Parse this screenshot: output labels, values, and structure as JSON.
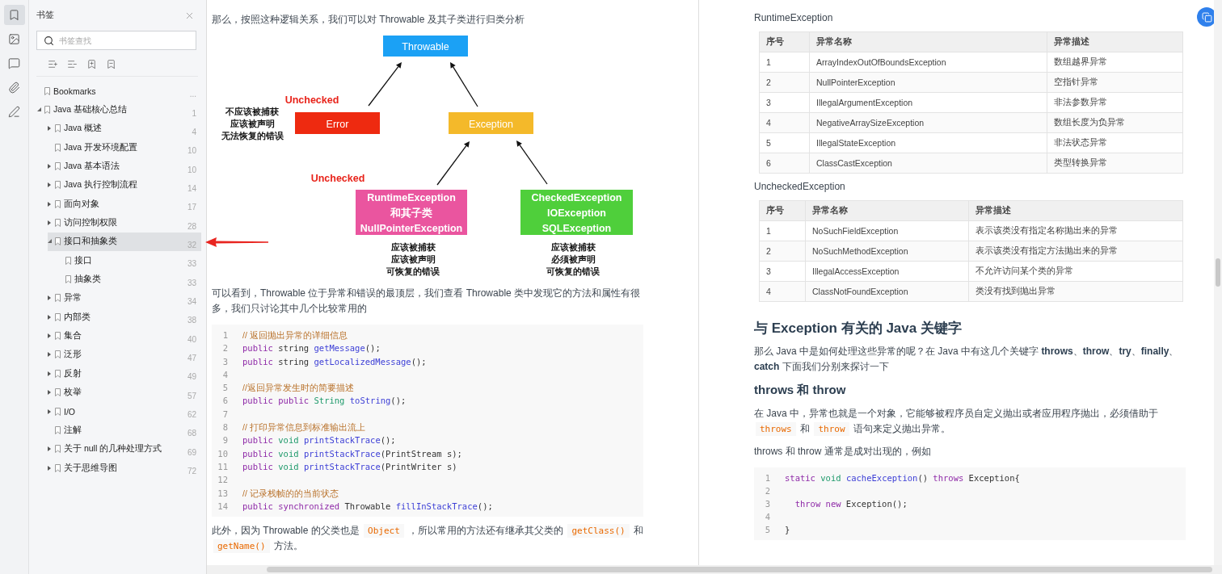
{
  "rail": [
    {
      "selected": true
    },
    {
      "selected": false
    },
    {
      "selected": false
    },
    {
      "selected": false
    },
    {
      "selected": false
    }
  ],
  "bookmark_panel": {
    "title": "书签",
    "search": {
      "placeholder": "书签查找"
    },
    "tree": [
      {
        "label": "Bookmarks",
        "page": "...",
        "kind": "leaf",
        "selected": false
      },
      {
        "label": "Java 基础核心总结",
        "page": "1",
        "kind": "folder",
        "expanded": true,
        "selected": false,
        "children": [
          {
            "label": "Java 概述",
            "page": "4",
            "kind": "folder",
            "expanded": false,
            "selected": false
          },
          {
            "label": "Java 开发环境配置",
            "page": "10",
            "kind": "leaf",
            "selected": false
          },
          {
            "label": "Java 基本语法",
            "page": "10",
            "kind": "folder",
            "expanded": false,
            "selected": false
          },
          {
            "label": "Java 执行控制流程",
            "page": "14",
            "kind": "folder",
            "expanded": false,
            "selected": false
          },
          {
            "label": "面向对象",
            "page": "17",
            "kind": "folder",
            "expanded": false,
            "selected": false
          },
          {
            "label": "访问控制权限",
            "page": "28",
            "kind": "folder",
            "expanded": false,
            "selected": false
          },
          {
            "label": "接口和抽象类",
            "page": "32",
            "kind": "folder",
            "expanded": true,
            "selected": true,
            "children": [
              {
                "label": "接口",
                "page": "33",
                "kind": "leaf",
                "selected": false
              },
              {
                "label": "抽象类",
                "page": "33",
                "kind": "leaf",
                "selected": false
              }
            ]
          },
          {
            "label": "异常",
            "page": "34",
            "kind": "folder",
            "expanded": false,
            "selected": false
          },
          {
            "label": "内部类",
            "page": "38",
            "kind": "folder",
            "expanded": false,
            "selected": false
          },
          {
            "label": "集合",
            "page": "40",
            "kind": "folder",
            "expanded": false,
            "selected": false
          },
          {
            "label": "泛形",
            "page": "47",
            "kind": "folder",
            "expanded": false,
            "selected": false
          },
          {
            "label": "反射",
            "page": "49",
            "kind": "folder",
            "expanded": false,
            "selected": false
          },
          {
            "label": "枚举",
            "page": "57",
            "kind": "folder",
            "expanded": false,
            "selected": false
          },
          {
            "label": "I/O",
            "page": "62",
            "kind": "folder",
            "expanded": false,
            "selected": false
          },
          {
            "label": "注解",
            "page": "68",
            "kind": "leaf",
            "selected": false
          },
          {
            "label": "关于 null 的几种处理方式",
            "page": "69",
            "kind": "folder",
            "expanded": false,
            "selected": false
          },
          {
            "label": "关于思维导图",
            "page": "72",
            "kind": "folder",
            "expanded": false,
            "selected": false
          }
        ]
      }
    ]
  },
  "left_page": {
    "intro": "那么，按照这种逻辑关系，我们可以对 Throwable 及其子类进行归类分析",
    "diagram": {
      "nodes": [
        {
          "lines": [
            "Throwable"
          ],
          "color": "#1ba1f5"
        },
        {
          "lines": [
            "Error"
          ],
          "color": "#ee2a10"
        },
        {
          "lines": [
            "Exception"
          ],
          "color": "#f4b92a"
        },
        {
          "lines": [
            "RuntimeException",
            "和其子类",
            "NullPointerException"
          ],
          "color": "#ea559f"
        },
        {
          "lines": [
            "CheckedException",
            "IOException",
            "SQLException"
          ],
          "color": "#4fcf3b"
        }
      ],
      "tags": [
        "Unchecked",
        "Unchecked"
      ],
      "notes": [
        [
          "不应该被捕获",
          "应该被声明",
          "无法恢复的错误"
        ],
        [
          "应该被捕获",
          "应该被声明",
          "可恢复的错误"
        ],
        [
          "应该被捕获",
          "必须被声明",
          "可恢复的错误"
        ]
      ]
    },
    "para": "可以看到，Throwable 位于异常和错误的最顶层，我们查看 Throwable 类中发现它的方法和属性有很多，我们只讨论其中几个比较常用的",
    "code": [
      {
        "n": "1",
        "tokens": [
          {
            "t": "// 返回抛出异常的详细信息",
            "kind": "comment"
          }
        ]
      },
      {
        "n": "2",
        "tokens": [
          {
            "t": "public",
            "kind": "keyword"
          },
          {
            "t": " string ",
            "kind": "plain"
          },
          {
            "t": "getMessage",
            "kind": "function"
          },
          {
            "t": "();",
            "kind": "plain"
          }
        ]
      },
      {
        "n": "3",
        "tokens": [
          {
            "t": "public",
            "kind": "keyword"
          },
          {
            "t": " string ",
            "kind": "plain"
          },
          {
            "t": "getLocalizedMessage",
            "kind": "function"
          },
          {
            "t": "();",
            "kind": "plain"
          }
        ]
      },
      {
        "n": "4"
      },
      {
        "n": "5",
        "tokens": [
          {
            "t": "//返回异常发生时的简要描述",
            "kind": "comment"
          }
        ]
      },
      {
        "n": "6",
        "tokens": [
          {
            "t": "public public ",
            "kind": "keyword"
          },
          {
            "t": "String ",
            "kind": "type"
          },
          {
            "t": "toString",
            "kind": "function"
          },
          {
            "t": "();",
            "kind": "plain"
          }
        ]
      },
      {
        "n": "7"
      },
      {
        "n": "8",
        "tokens": [
          {
            "t": "// 打印异常信息到标准输出流上",
            "kind": "comment"
          }
        ]
      },
      {
        "n": "9",
        "tokens": [
          {
            "t": "public ",
            "kind": "keyword"
          },
          {
            "t": "void ",
            "kind": "type"
          },
          {
            "t": "printStackTrace",
            "kind": "function"
          },
          {
            "t": "();",
            "kind": "plain"
          }
        ]
      },
      {
        "n": "10",
        "tokens": [
          {
            "t": "public ",
            "kind": "keyword"
          },
          {
            "t": "void ",
            "kind": "type"
          },
          {
            "t": "printStackTrace",
            "kind": "function"
          },
          {
            "t": "(PrintStream s);",
            "kind": "plain"
          }
        ]
      },
      {
        "n": "11",
        "tokens": [
          {
            "t": "public ",
            "kind": "keyword"
          },
          {
            "t": "void ",
            "kind": "type"
          },
          {
            "t": "printStackTrace",
            "kind": "function"
          },
          {
            "t": "(PrintWriter s)",
            "kind": "plain"
          }
        ]
      },
      {
        "n": "12"
      },
      {
        "n": "13",
        "tokens": [
          {
            "t": "// 记录栈帧的的当前状态",
            "kind": "comment"
          }
        ]
      },
      {
        "n": "14",
        "tokens": [
          {
            "t": "public synchronized",
            "kind": "keyword"
          },
          {
            "t": " Throwable ",
            "kind": "plain"
          },
          {
            "t": "fillInStackTrace",
            "kind": "function"
          },
          {
            "t": "();",
            "kind": "plain"
          }
        ]
      }
    ],
    "outro": [
      {
        "t": "此外，因为 Throwable 的父类也是 ",
        "kind": "text"
      },
      {
        "t": "Object",
        "kind": "code"
      },
      {
        "t": " ，所以常用的方法还有继承其父类的 ",
        "kind": "text"
      },
      {
        "t": "getClass()",
        "kind": "code"
      },
      {
        "t": " 和 ",
        "kind": "text"
      },
      {
        "t": "getName()",
        "kind": "code"
      },
      {
        "t": " 方法。",
        "kind": "text"
      }
    ]
  },
  "right_page": {
    "tables": [
      {
        "caption": "RuntimeException",
        "columns": [
          "序号",
          "异常名称",
          "异常描述"
        ],
        "rows": [
          [
            "1",
            "ArrayIndexOutOfBoundsException",
            "数组越界异常"
          ],
          [
            "2",
            "NullPointerException",
            "空指针异常"
          ],
          [
            "3",
            "IllegalArgumentException",
            "非法参数异常"
          ],
          [
            "4",
            "NegativeArraySizeException",
            "数组长度为负异常"
          ],
          [
            "5",
            "IllegalStateException",
            "非法状态异常"
          ],
          [
            "6",
            "ClassCastException",
            "类型转换异常"
          ]
        ]
      },
      {
        "caption": "UncheckedException",
        "columns": [
          "序号",
          "异常名称",
          "异常描述"
        ],
        "rows": [
          [
            "1",
            "NoSuchFieldException",
            "表示该类没有指定名称抛出来的异常"
          ],
          [
            "2",
            "NoSuchMethodException",
            "表示该类没有指定方法抛出来的异常"
          ],
          [
            "3",
            "IllegalAccessException",
            "不允许访问某个类的异常"
          ],
          [
            "4",
            "ClassNotFoundException",
            "类没有找到抛出异常"
          ]
        ]
      }
    ],
    "heading": "与 Exception 有关的 Java 关键字",
    "para1": "那么 Java 中是如何处理这些异常的呢？在 Java 中有这几个关键字 **throws**、**throw**、**try**、**finally**、**catch** 下面我们分别来探讨一下",
    "subheading": "throws 和 throw",
    "para2": [
      {
        "t": "在 Java 中，异常也就是一个对象，它能够被程序员自定义抛出或者应用程序抛出，必须借助于 ",
        "kind": "text"
      },
      {
        "t": "throws",
        "kind": "code"
      },
      {
        "t": " 和 ",
        "kind": "text"
      },
      {
        "t": "throw",
        "kind": "code"
      },
      {
        "t": " 语句来定义抛出异常。",
        "kind": "text"
      }
    ],
    "para3": "throws 和 throw 通常是成对出现的，例如",
    "code": [
      {
        "n": "1",
        "tokens": [
          {
            "t": "static ",
            "kind": "keyword"
          },
          {
            "t": "void ",
            "kind": "type"
          },
          {
            "t": "cacheException",
            "kind": "function"
          },
          {
            "t": "() ",
            "kind": "plain"
          },
          {
            "t": "throws",
            "kind": "keyword"
          },
          {
            "t": " Exception{",
            "kind": "plain"
          }
        ]
      },
      {
        "n": "2"
      },
      {
        "n": "3",
        "tokens": [
          {
            "t": "  throw new",
            "kind": "keyword"
          },
          {
            "t": " Exception();",
            "kind": "plain"
          }
        ]
      },
      {
        "n": "4"
      },
      {
        "n": "5",
        "tokens": [
          {
            "t": "}",
            "kind": "plain"
          }
        ]
      }
    ]
  }
}
